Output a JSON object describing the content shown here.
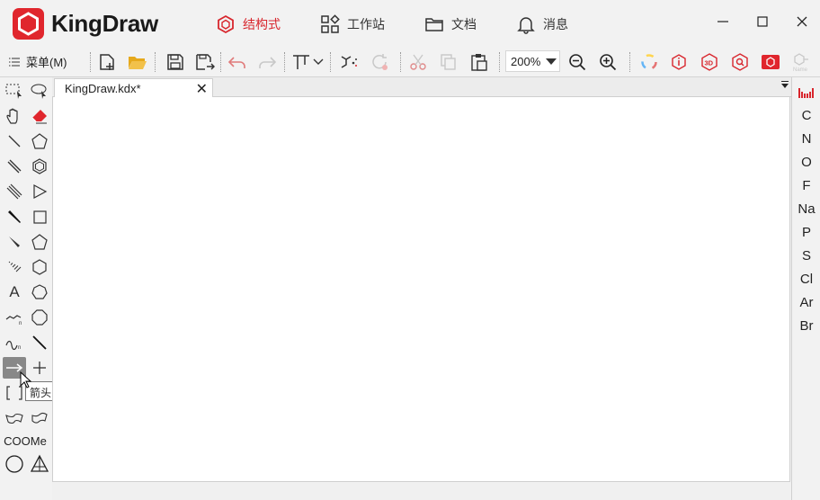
{
  "app": {
    "title": "KingDraw"
  },
  "nav": {
    "tabs": [
      {
        "label": "结构式",
        "icon": "structure-icon",
        "active": true
      },
      {
        "label": "工作站",
        "icon": "workstation-icon",
        "active": false
      },
      {
        "label": "文档",
        "icon": "folder-icon",
        "active": false
      },
      {
        "label": "消息",
        "icon": "bell-icon",
        "active": false
      }
    ],
    "active_color": "#d8262d"
  },
  "toolbar": {
    "menu_label": "菜单(M)",
    "zoom_value": "200%"
  },
  "document": {
    "tab_title": "KingDraw.kdx*",
    "close": "✕"
  },
  "left_tools": {
    "text_tool": "A",
    "coome_label": "COOMe",
    "tooltip": "箭头"
  },
  "elements": [
    "C",
    "N",
    "O",
    "F",
    "Na",
    "P",
    "S",
    "Cl",
    "Ar",
    "Br"
  ],
  "colors": {
    "brand": "#e0262d"
  }
}
